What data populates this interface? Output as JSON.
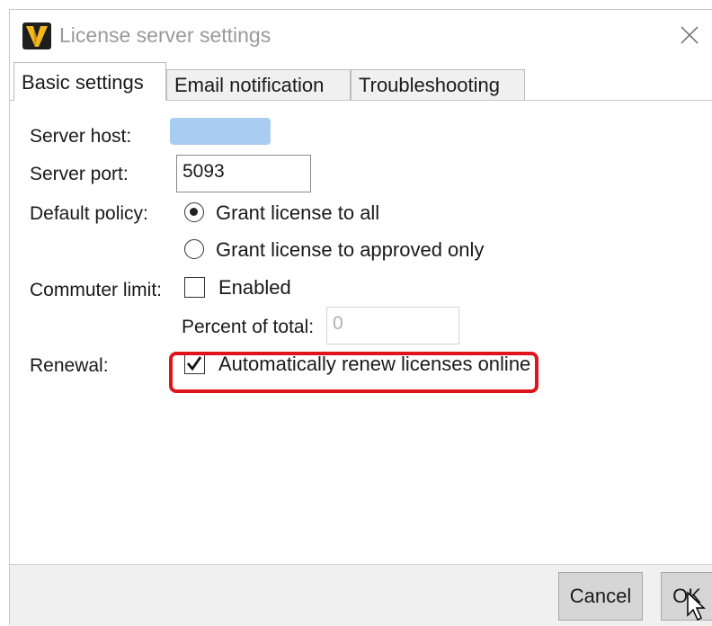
{
  "window": {
    "title": "License server settings",
    "app_icon": "v-logo-icon",
    "close_icon": "close-icon"
  },
  "tabs": [
    {
      "label": "Basic settings",
      "active": true
    },
    {
      "label": "Email notification",
      "active": false
    },
    {
      "label": "Troubleshooting",
      "active": false
    }
  ],
  "form": {
    "server_host_label": "Server host:",
    "server_port_label": "Server port:",
    "server_port_value": "5093",
    "default_policy_label": "Default policy:",
    "policy_options": [
      {
        "label": "Grant license to all",
        "selected": true
      },
      {
        "label": "Grant license to approved only",
        "selected": false
      }
    ],
    "commuter_limit_label": "Commuter limit:",
    "commuter_enabled_label": "Enabled",
    "commuter_enabled_checked": false,
    "percent_label": "Percent of total:",
    "percent_placeholder": "0",
    "renewal_label": "Renewal:",
    "renewal_option_label": "Automatically renew licenses online",
    "renewal_checked": true
  },
  "colors": {
    "highlight": "#e0141b",
    "host_redaction": "#a9cdf0",
    "app_icon_bg": "#1e1e1e",
    "app_icon_accent": "#f2b81c"
  },
  "footer": {
    "cancel_label": "Cancel",
    "ok_label": "OK"
  }
}
